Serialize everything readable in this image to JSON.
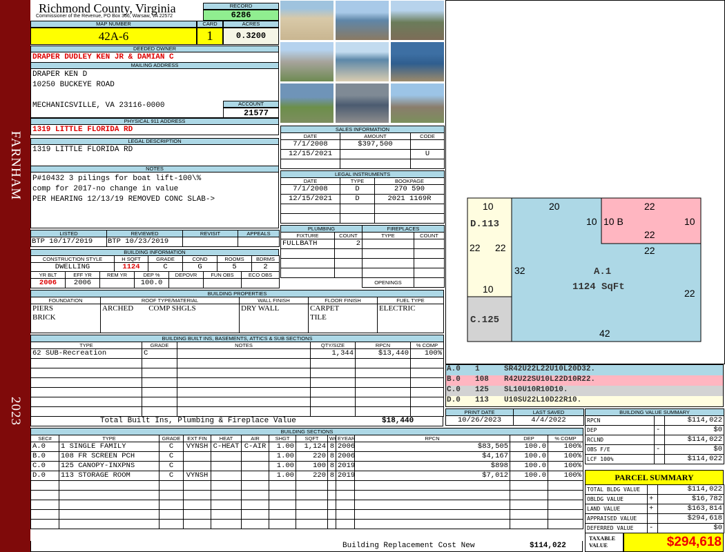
{
  "sidebar": {
    "town": "FARNHAM",
    "year": "2023"
  },
  "header": {
    "county": "Richmond County, Virginia",
    "subtitle": "Commissioner of the Revenue, PO Box 366, Warsaw, VA 22572",
    "record_label": "RECORD",
    "record": "6286",
    "map_label": "MAP NUMBER",
    "map_number": "42A-6",
    "card_label": "CARD",
    "card": "1",
    "acres_label": "ACRES",
    "acres": "0.3200"
  },
  "owner": {
    "label": "DEEDED OWNER",
    "name": "DRAPER DUDLEY KEN JR & DAMIAN C"
  },
  "mailing": {
    "label": "MAILING ADDRESS",
    "line1": "DRAPER KEN D",
    "line2": "10250 BUCKEYE ROAD",
    "line3": "MECHANICSVILLE, VA 23116-0000",
    "account_label": "ACCOUNT",
    "account": "21577"
  },
  "physical": {
    "label": "PHYSICAL 911 ADDRESS",
    "address": "1319 LITTLE FLORIDA RD"
  },
  "legal": {
    "label": "LEGAL DESCRIPTION",
    "text": "1319 LITTLE FLORIDA RD"
  },
  "notes": {
    "label": "NOTES",
    "lines": [
      "P#10432 3 pilings for boat lift-100\\%",
      "comp for 2017-no change in value",
      "PER HEARING 12/13/19 REMOVED CONC SLAB->"
    ]
  },
  "listing": {
    "headers": [
      "LISTED",
      "REVIEWED",
      "REVISIT",
      "APPEALS"
    ],
    "values": [
      "BTP 10/17/2019",
      "BTP 10/23/2019",
      "",
      ""
    ]
  },
  "building_info": {
    "label": "BUILDING INFORMATION",
    "h1": [
      "CONSTRUCTION STYLE",
      "H SQFT",
      "GRADE",
      "COND",
      "ROOMS",
      "BDRMS"
    ],
    "v1": [
      "DWELLING",
      "1124",
      "C",
      "G",
      "5",
      "2"
    ],
    "h2": [
      "YR BLT",
      "EFF YR",
      "REM YR",
      "DEP %",
      "DEPOVR",
      "FUN OBS",
      "ECO OBS"
    ],
    "v2": [
      "2006",
      "2006",
      "",
      "100.0",
      "",
      "",
      ""
    ]
  },
  "sales": {
    "label": "SALES INFORMATION",
    "headers": [
      "DATE",
      "AMOUNT",
      "CODE"
    ],
    "rows": [
      [
        "7/1/2008",
        "$397,500",
        ""
      ],
      [
        "12/15/2021",
        "",
        "U"
      ],
      [
        "",
        "",
        ""
      ]
    ]
  },
  "legal_instruments": {
    "label": "LEGAL INSTRUMENTS",
    "headers": [
      "DATE",
      "TYPE",
      "BOOKPAGE"
    ],
    "rows": [
      [
        "7/1/2008",
        "D",
        "270 590"
      ],
      [
        "12/15/2021",
        "D",
        "2021 1169R"
      ],
      [
        "",
        "",
        ""
      ],
      [
        "",
        "",
        ""
      ]
    ]
  },
  "plumbing": {
    "label": "PLUMBING",
    "headers": [
      "FIXTURE",
      "COUNT"
    ],
    "rows": [
      [
        "FULLBATH",
        "2"
      ],
      [
        "",
        ""
      ],
      [
        "",
        ""
      ],
      [
        "",
        ""
      ]
    ]
  },
  "fireplaces": {
    "label": "FIREPLACES",
    "headers": [
      "TYPE",
      "COUNT"
    ],
    "rows": [
      [
        "",
        ""
      ],
      [
        "",
        ""
      ],
      [
        "",
        ""
      ],
      [
        "",
        ""
      ]
    ],
    "openings_label": "OPENINGS",
    "openings": ""
  },
  "properties": {
    "label": "BUILDING PROPERTIES",
    "headers": [
      "FOUNDATION",
      "ROOF TYPE/MATERIAL",
      "WALL FINISH",
      "FLOOR FINISH",
      "FUEL TYPE"
    ],
    "values": [
      "PIERS\nBRICK",
      "ARCHED        COMP SHGLS",
      "DRY WALL",
      "CARPET\nTILE",
      "ELECTRIC"
    ]
  },
  "builtins": {
    "label": "BUILDING BUILT INS, BASEMENTS, ATTICS & SUB SECTIONS",
    "headers": [
      "TYPE",
      "GRADE",
      "NOTES",
      "QTY/SIZE",
      "RPCN",
      "% COMP"
    ],
    "rows": [
      [
        "62 SUB-Recreation",
        "C",
        "",
        "1,344",
        "$13,440",
        "100%"
      ],
      [
        "",
        "",
        "",
        "",
        "",
        ""
      ],
      [
        "",
        "",
        "",
        "",
        "",
        ""
      ],
      [
        "",
        "",
        "",
        "",
        "",
        ""
      ],
      [
        "",
        "",
        "",
        "",
        "",
        ""
      ],
      [
        "",
        "",
        "",
        "",
        "",
        ""
      ],
      [
        "",
        "",
        "",
        "",
        "",
        ""
      ]
    ],
    "total_label": "Total Built Ins, Plumbing & Fireplace Value",
    "total": "$18,440"
  },
  "dates": {
    "print_label": "PRINT DATE",
    "print": "10/26/2023",
    "saved_label": "LAST SAVED",
    "saved": "4/4/2022"
  },
  "sections": {
    "label": "BUILDING SECTIONS",
    "headers": [
      "SEC#",
      "TYPE",
      "GRADE",
      "EXT FIN",
      "HEAT",
      "AIR",
      "SHGT",
      "SQFT",
      "WHGT",
      "EYEAR",
      "RPCN",
      "DEP",
      "% COMP"
    ],
    "rows": [
      [
        "A.0",
        "1 SINGLE FAMILY",
        "C",
        "VYNSH",
        "C-HEAT",
        "C-AIR",
        "1.00",
        "1,124",
        "8",
        "2006",
        "$83,505",
        "100.0",
        "100%"
      ],
      [
        "B.0",
        "108 FR SCREEN PCH",
        "C",
        "",
        "",
        "",
        "1.00",
        "220",
        "8",
        "2006",
        "$4,167",
        "100.0",
        "100%"
      ],
      [
        "C.0",
        "125 CANOPY-INXPNS",
        "C",
        "",
        "",
        "",
        "1.00",
        "100",
        "8",
        "2019",
        "$898",
        "100.0",
        "100%"
      ],
      [
        "D.0",
        "113 STORAGE ROOM",
        "C",
        "VYNSH",
        "",
        "",
        "1.00",
        "220",
        "8",
        "2019",
        "$7,012",
        "100.0",
        "100%"
      ],
      [
        "",
        "",
        "",
        "",
        "",
        "",
        "",
        "",
        "",
        "",
        "",
        "",
        ""
      ],
      [
        "",
        "",
        "",
        "",
        "",
        "",
        "",
        "",
        "",
        "",
        "",
        "",
        ""
      ],
      [
        "",
        "",
        "",
        "",
        "",
        "",
        "",
        "",
        "",
        "",
        "",
        "",
        ""
      ],
      [
        "",
        "",
        "",
        "",
        "",
        "",
        "",
        "",
        "",
        "",
        "",
        "",
        ""
      ],
      [
        "",
        "",
        "",
        "",
        "",
        "",
        "",
        "",
        "",
        "",
        "",
        "",
        ""
      ]
    ],
    "total_label": "Building Replacement Cost New",
    "total": "$114,022"
  },
  "sketch": {
    "labels": {
      "d": "D.113",
      "c": "C.125",
      "a": "A.1",
      "a_area": "1124 SqFt",
      "b": "10 B"
    },
    "dims": [
      "10",
      "22",
      "22",
      "10",
      "20",
      "10",
      "22",
      "10",
      "22",
      "22",
      "32",
      "22",
      "42"
    ],
    "colors": {
      "a": "#add8e6",
      "b": "#ffb6c1",
      "c": "#d3d3d3",
      "d": "#fffde0"
    },
    "codes": [
      [
        "A.0",
        "1",
        "SR42U22L22U10L20D32."
      ],
      [
        "B.0",
        "108",
        "R42U22SU10L22D10R22."
      ],
      [
        "C.0",
        "125",
        "SL10U10R10D10."
      ],
      [
        "D.0",
        "113",
        "U10SU22L10D22R10."
      ]
    ]
  },
  "value_summary": {
    "label": "BUILDING VALUE SUMMARY",
    "rows": [
      [
        "RPCN",
        "",
        "$114,022"
      ],
      [
        "DEP",
        "-",
        "$0"
      ],
      [
        "RCLND",
        "",
        "$114,022"
      ],
      [
        "OBS F/E",
        "-",
        "$0"
      ],
      [
        "LCF 100%",
        "",
        "$114,022"
      ]
    ]
  },
  "parcel": {
    "label": "PARCEL SUMMARY",
    "rows": [
      [
        "TOTAL BLDG VALUE",
        "",
        "$114,022"
      ],
      [
        "OBLDG VALUE",
        "+",
        "$16,782"
      ],
      [
        "LAND VALUE",
        "+",
        "$163,814"
      ],
      [
        "APPRAISED VALUE",
        "",
        "$294,618"
      ],
      [
        "DEFERRED VALUE",
        "-",
        "$0"
      ]
    ],
    "taxable_label": "TAXABLE VALUE",
    "taxable": "$294,618"
  }
}
